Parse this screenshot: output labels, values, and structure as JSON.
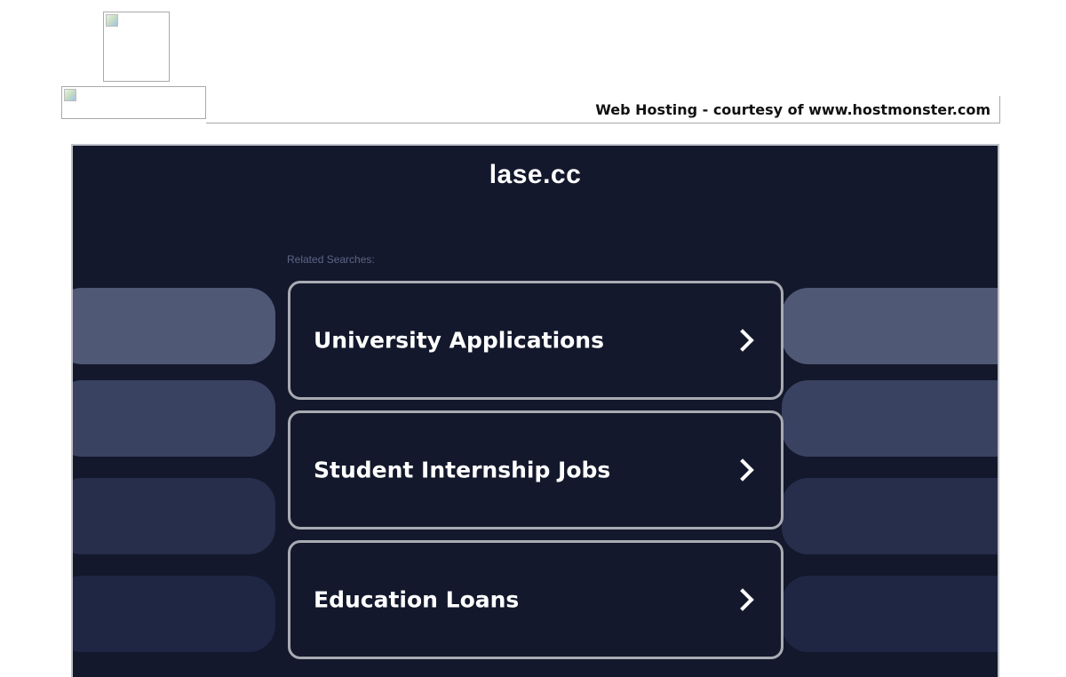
{
  "header": {
    "hosting_text": "Web Hosting - courtesy of www.hostmonster.com",
    "top_image_icon": "broken-image-icon",
    "bottom_image_icon": "broken-image-icon"
  },
  "parked_page": {
    "domain": "lase.cc",
    "related_label": "Related Searches:",
    "colors": {
      "background": "#13182c",
      "card_border": "#a8abb2",
      "related_label": "#5d6586",
      "pill_shades": [
        "#4f5875",
        "#3a4261",
        "#272e4b",
        "#1e2644"
      ]
    },
    "results": [
      {
        "label": "University Applications",
        "icon": "chevron-right-icon"
      },
      {
        "label": "Student Internship Jobs",
        "icon": "chevron-right-icon"
      },
      {
        "label": "Education Loans",
        "icon": "chevron-right-icon"
      }
    ]
  }
}
